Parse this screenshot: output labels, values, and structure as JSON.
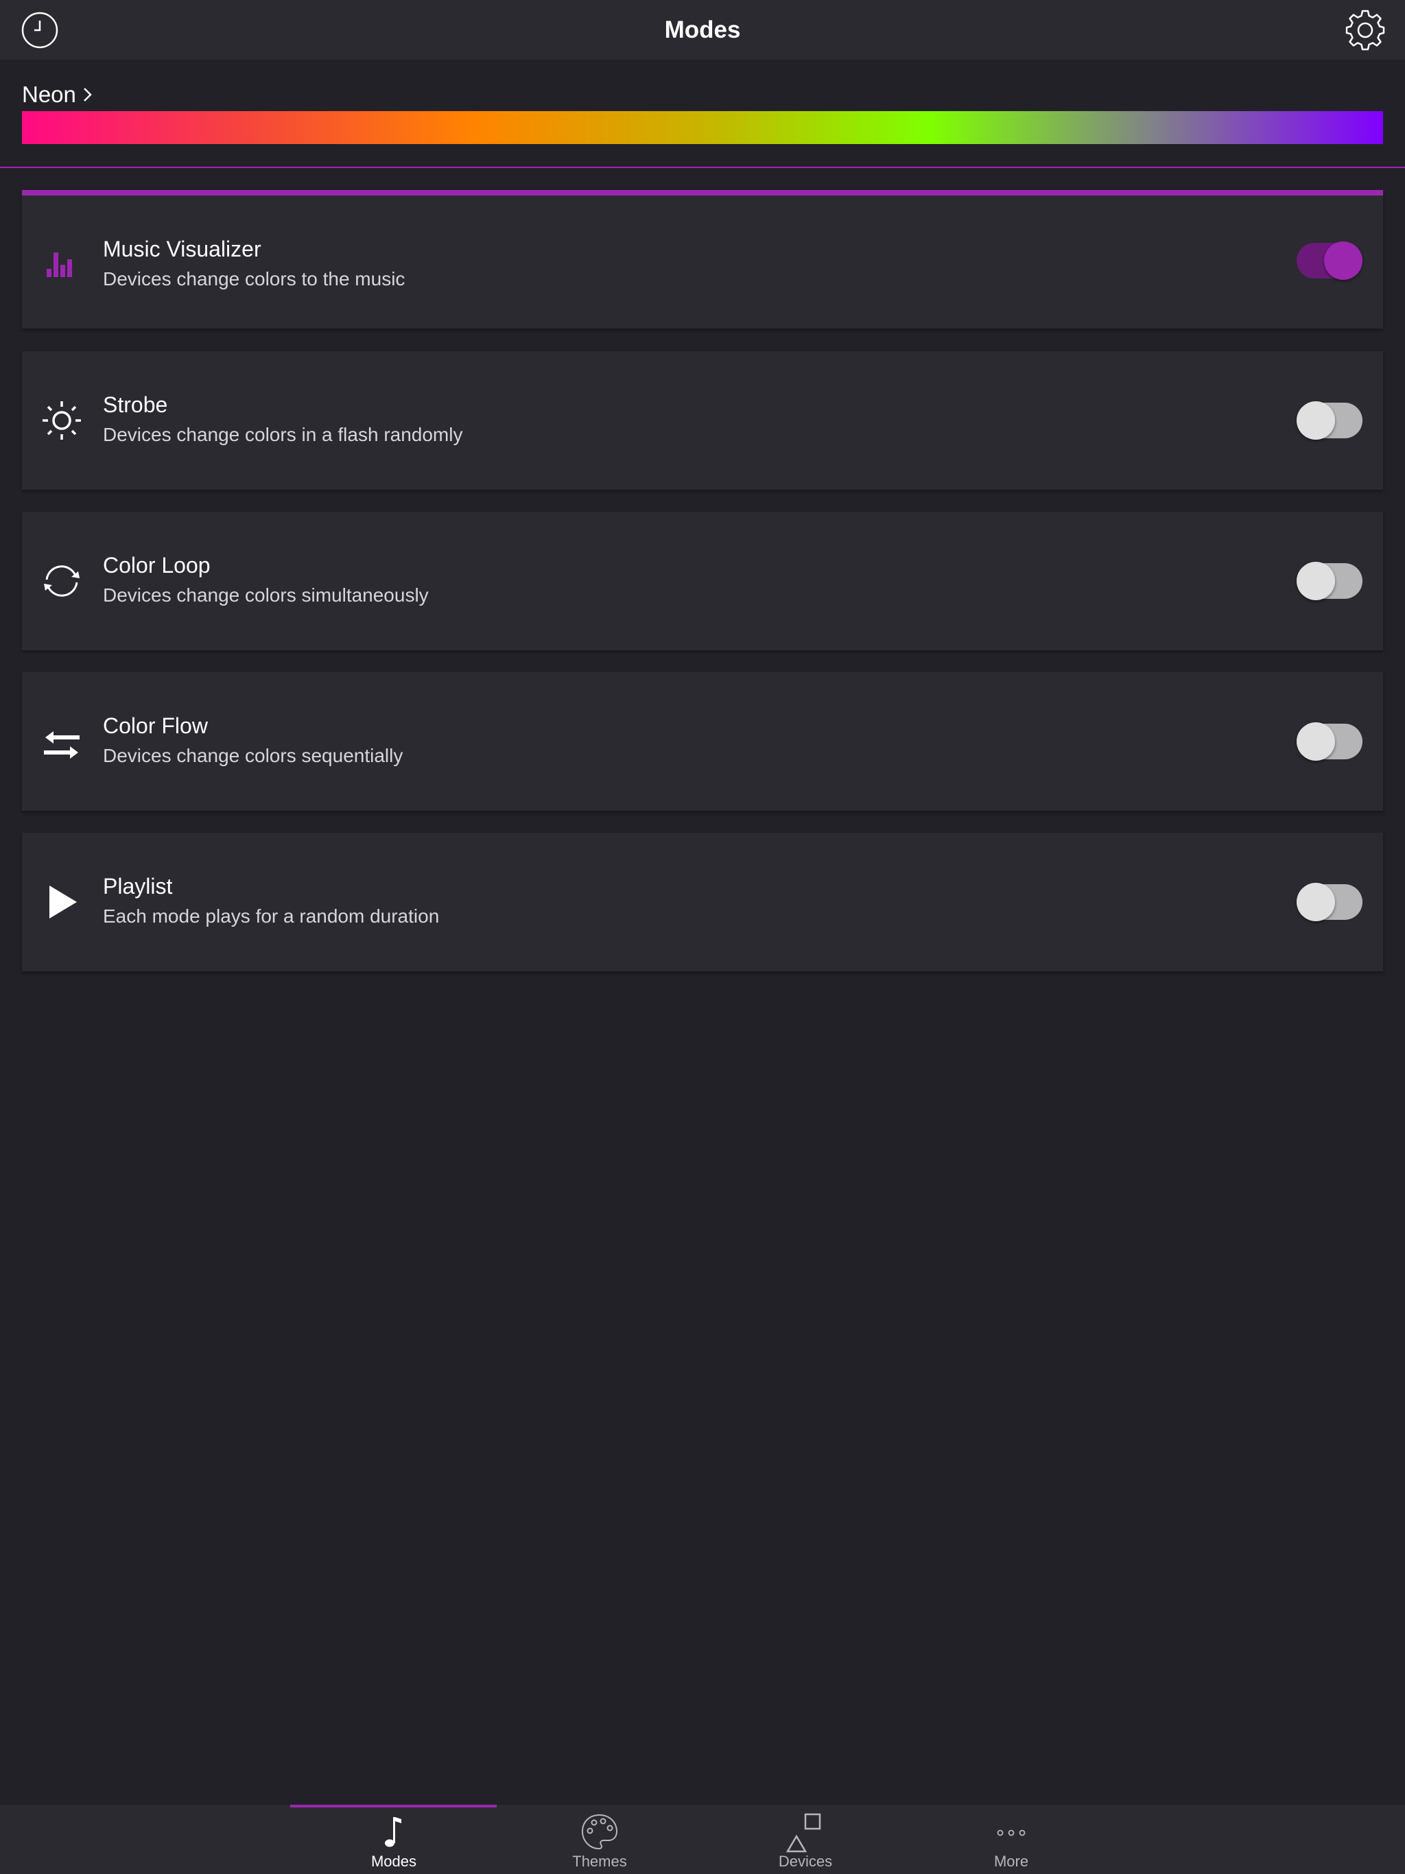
{
  "header": {
    "title": "Modes",
    "history_icon": "clock-icon",
    "settings_icon": "gear-icon"
  },
  "theme": {
    "name": "Neon",
    "gradient_colors": [
      "#ff0a84",
      "#f5463c",
      "#ff8400",
      "#c8b400",
      "#7fff00",
      "#80808a",
      "#8000ff"
    ]
  },
  "colors": {
    "accent": "#9b27af",
    "background": "#222128",
    "card": "#2b2a31"
  },
  "modes": [
    {
      "title": "Music Visualizer",
      "description": "Devices change colors to the music",
      "icon": "bar-chart-icon",
      "enabled": true
    },
    {
      "title": "Strobe",
      "description": "Devices change colors in a flash randomly",
      "icon": "sun-icon",
      "enabled": false
    },
    {
      "title": "Color Loop",
      "description": "Devices change colors simultaneously",
      "icon": "loop-arrows-icon",
      "enabled": false
    },
    {
      "title": "Color Flow",
      "description": "Devices change colors sequentially",
      "icon": "swap-arrows-icon",
      "enabled": false
    },
    {
      "title": "Playlist",
      "description": "Each mode plays for a random duration",
      "icon": "play-icon",
      "enabled": false
    }
  ],
  "nav": {
    "active": "Modes",
    "items": [
      {
        "label": "Modes",
        "icon": "music-note-icon"
      },
      {
        "label": "Themes",
        "icon": "palette-icon"
      },
      {
        "label": "Devices",
        "icon": "shapes-icon"
      },
      {
        "label": "More",
        "icon": "more-dots-icon"
      }
    ]
  }
}
